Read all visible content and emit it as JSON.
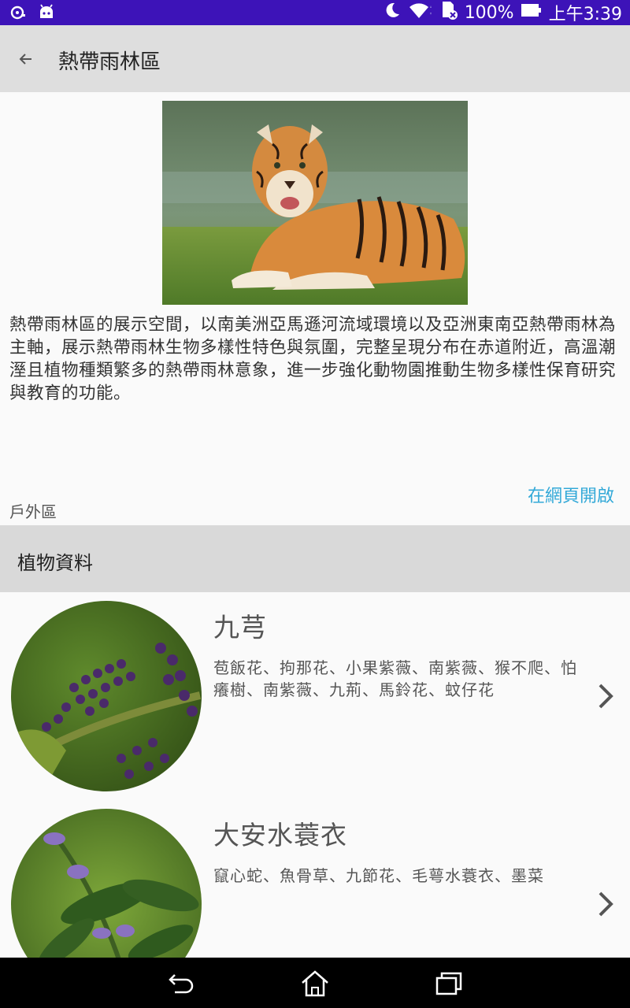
{
  "status_bar": {
    "battery": "100%",
    "time": "上午3:39",
    "icons": [
      "sync-icon",
      "android-icon",
      "moon-icon",
      "wifi-icon",
      "sd-card-icon",
      "battery-icon"
    ]
  },
  "toolbar": {
    "title": "熱帶雨林區",
    "back_icon": "arrow-back-icon"
  },
  "hero": {
    "subject": "tiger lying on grass by water"
  },
  "area": {
    "description": "熱帶雨林區的展示空間，以南美洲亞馬遜河流域環境以及亞洲東南亞熱帶雨林為主軸，展示熱帶雨林生物多樣性特色與氛圍，完整呈現分布在赤道附近，高溫潮溼且植物種類繁多的熱帶雨林意象，進一步強化動物園推動生物多樣性保育研究與教育的功能。",
    "category": "戶外區",
    "open_web_label": "在網頁開啟"
  },
  "plants_section": {
    "title": "植物資料",
    "items": [
      {
        "name": "九芎",
        "aliases": "苞飯花、拘那花、小果紫薇、南紫薇、猴不爬、怕癢樹、南紫薇、九荊、馬鈴花、蚊仔花"
      },
      {
        "name": "大安水蓑衣",
        "aliases": "竄心蛇、魚骨草、九節花、毛萼水蓑衣、墨菜"
      }
    ]
  },
  "nav_bar": {
    "icons": [
      "back-nav-icon",
      "home-nav-icon",
      "recents-nav-icon"
    ]
  },
  "colors": {
    "status_bar": "#3d13b8",
    "toolbar": "#dedede",
    "section_header": "#d9d9d9",
    "link": "#33a9d8"
  }
}
